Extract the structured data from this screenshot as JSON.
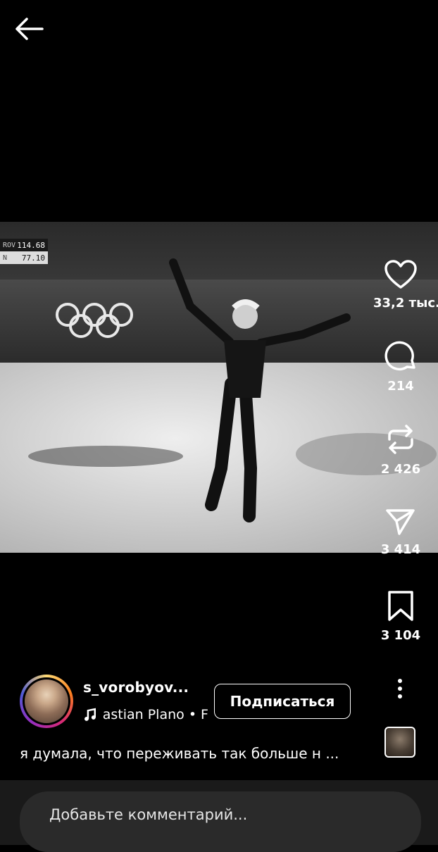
{
  "top_bar": {
    "back_icon": "arrow-left-icon"
  },
  "video": {
    "scoreboard": {
      "row1_name": "ROV",
      "row1_score": "114.68",
      "row2_name": "N",
      "row2_score": "77.10"
    }
  },
  "actions": {
    "like": {
      "icon": "heart-icon",
      "count": "33,2 тыс."
    },
    "comment": {
      "icon": "comment-bubble-icon",
      "count": "214"
    },
    "repost": {
      "icon": "repost-icon",
      "count": "2 426"
    },
    "share": {
      "icon": "send-icon",
      "count": "3 414"
    },
    "save": {
      "icon": "bookmark-icon",
      "count": "3 104"
    }
  },
  "author": {
    "username": "s_vorobyov...",
    "music": "astian Plano • F",
    "follow_label": "Подписаться"
  },
  "caption": "я думала, что переживать так больше н ...",
  "comment_box": {
    "placeholder": "Добавьте комментарий..."
  },
  "colors": {
    "background": "#000000",
    "comment_bar": "#1a1a1a",
    "input_bg": "#2a2a2a"
  }
}
